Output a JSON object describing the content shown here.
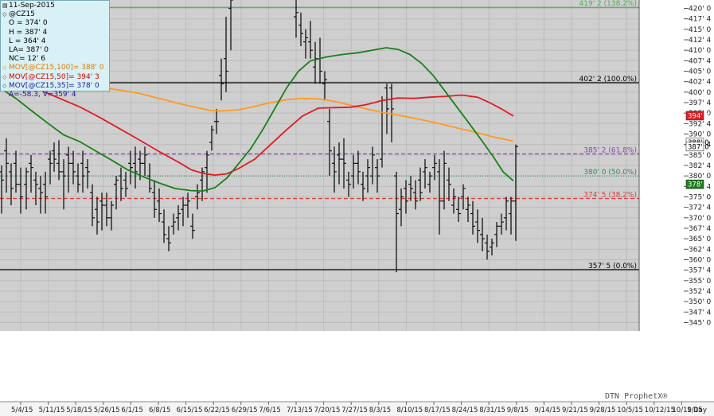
{
  "chart_data": {
    "type": "ohlc",
    "symbol": "@CZ15",
    "info": {
      "date": "11-Sep-2015",
      "symbol": "@CZ15",
      "open": "O = 374' 0",
      "high": "H = 387' 4",
      "low": "L = 364' 4",
      "last": "LA= 387' 0",
      "net_change": "NC= 12' 6",
      "ma100": "MOV[@CZ15,100]= 388' 0",
      "ma50": "MOV[@CZ15,50]= 394' 3",
      "ma35": "MOV[@CZ15,35]= 378' 0",
      "cursor": "A=-58.3, V=359' 4"
    },
    "ylim": [
      343,
      422
    ],
    "yticks": [
      345,
      347.5,
      350,
      352.5,
      355,
      357.5,
      360,
      362.5,
      365,
      367.5,
      370,
      372.5,
      375,
      377.5,
      380,
      382.5,
      385,
      387.5,
      390,
      392.5,
      395,
      397.5,
      400,
      402.5,
      405,
      407.5,
      410,
      412.5,
      415,
      417.5,
      420
    ],
    "ytick_labels": [
      "345' 0",
      "347' 4",
      "350' 0",
      "352' 4",
      "355' 0",
      "357' 4",
      "360' 0",
      "362' 4",
      "365' 0",
      "367' 4",
      "370' 0",
      "372' 4",
      "375' 0",
      "377' 4",
      "380' 0",
      "382' 4",
      "385' 0",
      "387' 4",
      "390' 0",
      "392' 4",
      "395' 0",
      "397' 4",
      "400' 0",
      "402' 4",
      "405' 0",
      "407' 4",
      "410' 0",
      "412' 4",
      "415' 0",
      "417' 4",
      "420' 0"
    ],
    "xlabels": [
      "5/4/15",
      "5/11/15",
      "5/18/15",
      "5/26/15",
      "6/1/15",
      "6/8/15",
      "6/15/15",
      "6/22/15",
      "6/29/15",
      "7/6/15",
      "7/13/15",
      "7/20/15",
      "7/27/15",
      "8/3/15",
      "8/10/15",
      "8/17/15",
      "8/24/15",
      "8/31/15",
      "9/8/15",
      "9/14/15",
      "9/21/15",
      "9/28/15",
      "10/5/15",
      "10/12/15",
      "10/19/15"
    ],
    "xaxis_right_label": "1 Day",
    "levels": [
      {
        "price": 420.25,
        "label": "419' 2 (138.2%)",
        "color": "#4caf50",
        "style": "solid"
      },
      {
        "price": 402.25,
        "label": "402' 2 (100.0%)",
        "color": "#000000",
        "style": "solid"
      },
      {
        "price": 385.25,
        "label": "385' 2 (61.8%)",
        "color": "#8e44ad",
        "style": "dashed"
      },
      {
        "price": 380,
        "label": "380' 0 (50.0%)",
        "color": "#2e8b57",
        "style": "dotted"
      },
      {
        "price": 374.625,
        "label": "374' 5 (38.2%)",
        "color": "#e53935",
        "style": "dashed"
      },
      {
        "price": 357.625,
        "label": "357' 5 (0.0%)",
        "color": "#000000",
        "style": "solid"
      }
    ],
    "price_tags": [
      {
        "price": 394.375,
        "label": "394' 3",
        "bg": "#e31b23",
        "fg": "#ffffff"
      },
      {
        "price": 388,
        "label": "388' 0",
        "bg": "#ffffff",
        "fg": "#000000"
      },
      {
        "price": 387,
        "label": "387' 0",
        "bg": "#ffffff",
        "fg": "#000000"
      },
      {
        "price": 378,
        "label": "378' 0",
        "bg": "#1e7d1e",
        "fg": "#ffffff"
      }
    ],
    "series": [
      {
        "name": "MOV[@CZ15,100]",
        "color": "#ff9a1f",
        "points": [
          [
            0,
            406
          ],
          [
            25,
            405
          ],
          [
            50,
            404
          ],
          [
            75,
            403
          ],
          [
            100,
            402
          ],
          [
            125,
            401.2
          ],
          [
            150,
            400.5
          ],
          [
            175,
            399.7
          ],
          [
            200,
            398.5
          ],
          [
            225,
            397.3
          ],
          [
            250,
            396.2
          ],
          [
            265,
            395.6
          ],
          [
            280,
            395.5
          ],
          [
            300,
            395.8
          ],
          [
            320,
            396.6
          ],
          [
            340,
            397.5
          ],
          [
            360,
            398.2
          ],
          [
            380,
            398.5
          ],
          [
            400,
            398.4
          ],
          [
            420,
            397.8
          ],
          [
            440,
            396.9
          ],
          [
            460,
            396
          ],
          [
            480,
            395.2
          ],
          [
            500,
            394.5
          ],
          [
            520,
            393.8
          ],
          [
            540,
            393
          ],
          [
            560,
            392.1
          ],
          [
            580,
            391.2
          ],
          [
            600,
            390.3
          ],
          [
            620,
            389.3
          ],
          [
            645,
            388.3
          ]
        ]
      },
      {
        "name": "MOV[@CZ15,50]",
        "color": "#e31b23",
        "points": [
          [
            0,
            404.5
          ],
          [
            25,
            402.5
          ],
          [
            50,
            400.5
          ],
          [
            75,
            398.5
          ],
          [
            100,
            396.5
          ],
          [
            125,
            394
          ],
          [
            150,
            391.3
          ],
          [
            175,
            388.6
          ],
          [
            200,
            385.8
          ],
          [
            225,
            383.2
          ],
          [
            240,
            381.5
          ],
          [
            255,
            380.6
          ],
          [
            270,
            380.2
          ],
          [
            285,
            380.5
          ],
          [
            300,
            381.8
          ],
          [
            320,
            384
          ],
          [
            340,
            387.5
          ],
          [
            360,
            391
          ],
          [
            380,
            394.3
          ],
          [
            400,
            396.2
          ],
          [
            420,
            396.3
          ],
          [
            440,
            396.4
          ],
          [
            460,
            397
          ],
          [
            480,
            398
          ],
          [
            500,
            398.6
          ],
          [
            520,
            398.5
          ],
          [
            540,
            398.8
          ],
          [
            560,
            399
          ],
          [
            580,
            399.3
          ],
          [
            600,
            398.8
          ],
          [
            615,
            397.5
          ],
          [
            630,
            396
          ],
          [
            645,
            394.3
          ]
        ]
      },
      {
        "name": "MOV[@CZ15,35]",
        "color": "#1a7f1a",
        "points": [
          [
            0,
            401
          ],
          [
            20,
            398.5
          ],
          [
            40,
            395.5
          ],
          [
            60,
            392.6
          ],
          [
            80,
            389.8
          ],
          [
            100,
            388.2
          ],
          [
            120,
            386
          ],
          [
            140,
            383.8
          ],
          [
            160,
            381.5
          ],
          [
            180,
            379.8
          ],
          [
            200,
            378.3
          ],
          [
            220,
            377
          ],
          [
            240,
            376.5
          ],
          [
            255,
            376.4
          ],
          [
            270,
            377.2
          ],
          [
            285,
            379.5
          ],
          [
            300,
            383
          ],
          [
            315,
            386.5
          ],
          [
            330,
            391
          ],
          [
            345,
            396
          ],
          [
            360,
            401
          ],
          [
            375,
            405
          ],
          [
            390,
            407.5
          ],
          [
            410,
            408.4
          ],
          [
            430,
            409
          ],
          [
            450,
            409.4
          ],
          [
            470,
            410.1
          ],
          [
            485,
            410.6
          ],
          [
            500,
            410.2
          ],
          [
            515,
            409
          ],
          [
            530,
            406.8
          ],
          [
            545,
            403.8
          ],
          [
            560,
            400
          ],
          [
            575,
            396.2
          ],
          [
            590,
            392.4
          ],
          [
            605,
            388.5
          ],
          [
            620,
            384.5
          ],
          [
            632,
            381
          ],
          [
            645,
            378.8
          ]
        ]
      }
    ],
    "bars": [
      [
        2,
        381,
        382.5,
        371,
        379
      ],
      [
        8,
        386,
        389,
        376,
        383
      ],
      [
        14,
        381,
        383,
        373,
        377
      ],
      [
        20,
        383,
        386,
        376,
        378
      ],
      [
        26,
        378,
        382,
        371,
        375
      ],
      [
        33,
        378,
        382,
        372,
        381
      ],
      [
        39,
        383,
        385,
        376,
        382
      ],
      [
        45,
        379,
        381,
        373,
        378
      ],
      [
        51,
        377,
        380,
        371,
        376
      ],
      [
        57,
        378,
        381,
        371,
        375
      ],
      [
        63,
        384,
        386,
        378,
        383
      ],
      [
        68,
        386,
        388,
        381,
        384
      ],
      [
        74,
        383,
        388.5,
        379,
        381
      ],
      [
        80,
        381,
        384,
        372,
        380
      ],
      [
        86,
        385,
        387,
        376,
        383
      ],
      [
        92,
        383,
        386,
        378,
        381
      ],
      [
        98,
        380,
        383,
        376,
        378
      ],
      [
        104,
        383,
        386,
        376,
        380
      ],
      [
        110,
        382,
        384,
        377,
        381
      ],
      [
        116,
        376,
        378,
        368,
        370
      ],
      [
        122,
        372,
        375,
        366,
        369
      ],
      [
        128,
        374,
        376,
        367,
        373
      ],
      [
        134,
        373,
        376,
        368,
        370
      ],
      [
        140,
        370,
        374,
        367,
        373
      ],
      [
        146,
        378,
        380,
        372,
        379
      ],
      [
        152,
        380,
        382,
        374,
        377
      ],
      [
        158,
        379,
        381,
        375,
        377
      ],
      [
        164,
        383,
        386,
        378,
        382
      ],
      [
        170,
        383,
        387,
        377,
        381
      ],
      [
        176,
        384,
        386,
        379,
        383
      ],
      [
        182,
        383,
        387,
        380,
        385
      ],
      [
        188,
        380,
        383,
        376,
        377
      ],
      [
        194,
        376,
        379,
        370,
        372
      ],
      [
        200,
        374,
        377,
        369,
        371
      ],
      [
        206,
        369,
        372,
        364,
        366
      ],
      [
        212,
        365,
        368,
        362,
        364
      ],
      [
        218,
        368,
        371,
        366,
        369
      ],
      [
        224,
        370,
        373,
        367,
        371
      ],
      [
        230,
        372,
        375,
        368,
        373
      ],
      [
        236,
        373,
        376,
        370,
        374
      ],
      [
        242,
        368,
        371,
        365,
        367
      ],
      [
        248,
        375,
        378,
        372,
        376
      ],
      [
        254,
        379,
        382,
        374,
        381
      ],
      [
        260,
        382,
        386,
        376,
        385
      ],
      [
        266,
        388,
        392,
        386,
        391
      ],
      [
        272,
        393,
        396,
        390,
        393
      ],
      [
        278,
        404,
        408,
        398,
        402
      ],
      [
        284,
        408,
        418,
        400,
        405
      ],
      [
        290,
        420,
        426,
        410,
        422
      ],
      [
        372,
        418,
        423,
        413,
        419
      ],
      [
        378,
        416,
        419,
        411,
        414
      ],
      [
        384,
        412,
        415,
        408,
        413
      ],
      [
        390,
        412,
        417,
        408,
        410
      ],
      [
        396,
        406,
        412,
        402,
        408
      ],
      [
        402,
        408,
        413,
        402,
        405
      ],
      [
        408,
        402,
        405,
        398,
        403
      ],
      [
        414,
        393,
        396,
        380,
        386
      ],
      [
        420,
        383,
        387,
        376,
        381
      ],
      [
        426,
        385,
        388,
        378,
        384
      ],
      [
        432,
        384,
        389,
        377,
        383
      ],
      [
        438,
        379,
        381,
        375,
        378
      ],
      [
        444,
        380,
        385,
        377,
        383
      ],
      [
        450,
        383,
        386,
        378,
        381
      ],
      [
        456,
        378,
        381,
        374,
        377
      ],
      [
        462,
        380,
        384,
        376,
        382
      ],
      [
        468,
        380,
        387,
        378,
        385
      ],
      [
        474,
        382,
        384,
        376,
        380
      ],
      [
        480,
        384,
        399,
        382,
        398
      ],
      [
        486,
        401,
        402,
        390,
        396
      ],
      [
        492,
        401,
        402,
        388,
        396
      ],
      [
        498,
        380,
        381,
        357,
        371
      ],
      [
        504,
        372,
        377,
        368,
        375
      ],
      [
        510,
        377,
        379,
        371,
        374
      ],
      [
        516,
        378,
        380,
        374,
        377
      ],
      [
        522,
        376,
        379,
        372,
        374
      ],
      [
        528,
        379,
        382,
        374,
        376
      ],
      [
        534,
        381,
        384,
        377,
        382
      ],
      [
        540,
        378,
        381,
        376,
        380
      ],
      [
        546,
        382,
        385,
        379,
        383
      ],
      [
        552,
        381,
        384,
        366,
        374
      ],
      [
        558,
        374,
        386,
        372,
        383
      ],
      [
        564,
        379,
        382,
        374,
        378
      ],
      [
        570,
        373,
        377,
        371,
        375
      ],
      [
        576,
        372,
        375,
        369,
        371
      ],
      [
        582,
        375,
        378,
        372,
        377
      ],
      [
        588,
        372,
        375,
        369,
        373
      ],
      [
        594,
        371,
        374,
        366,
        368
      ],
      [
        600,
        369,
        372,
        364,
        367
      ],
      [
        606,
        366,
        370,
        362,
        365
      ],
      [
        612,
        364,
        366,
        360,
        362
      ],
      [
        618,
        363,
        365,
        361,
        364
      ],
      [
        624,
        366,
        369,
        363,
        368
      ],
      [
        630,
        368,
        371,
        366,
        369
      ],
      [
        636,
        370,
        375,
        367,
        374
      ],
      [
        642,
        371,
        375,
        366,
        374
      ],
      [
        648,
        374,
        387.5,
        364.5,
        387
      ]
    ]
  }
}
